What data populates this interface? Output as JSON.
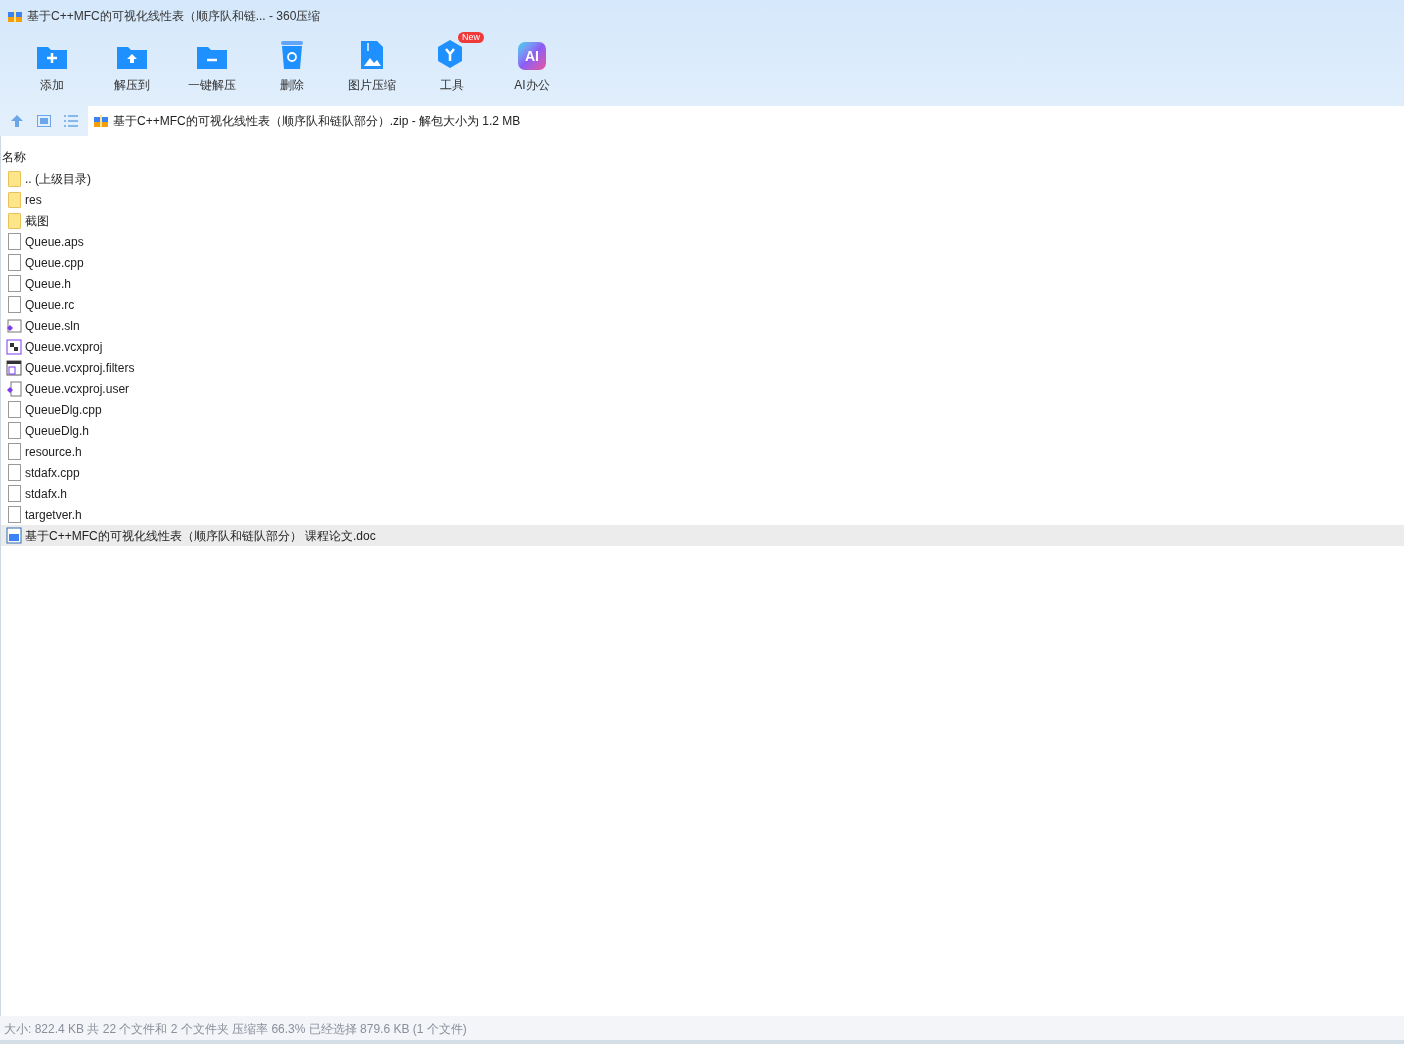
{
  "window": {
    "title": "基于C++MFC的可视化线性表（顺序队和链... - 360压缩"
  },
  "toolbar": [
    {
      "label": "添加",
      "kind": "add"
    },
    {
      "label": "解压到",
      "kind": "extract"
    },
    {
      "label": "一键解压",
      "kind": "oneclick"
    },
    {
      "label": "删除",
      "kind": "delete"
    },
    {
      "label": "图片压缩",
      "kind": "image"
    },
    {
      "label": "工具",
      "kind": "tools",
      "badge": "New"
    },
    {
      "label": "AI办公",
      "kind": "ai",
      "icon_text": "AI"
    }
  ],
  "address": {
    "path": "基于C++MFC的可视化线性表（顺序队和链队部分）.zip - 解包大小为 1.2 MB"
  },
  "table": {
    "columns": [
      "名称"
    ],
    "rows": [
      {
        "name": ".. (上级目录)",
        "kind": "folder",
        "selected": false
      },
      {
        "name": "res",
        "kind": "folder",
        "selected": false
      },
      {
        "name": "截图",
        "kind": "folder",
        "selected": false
      },
      {
        "name": "Queue.aps",
        "kind": "file",
        "selected": false
      },
      {
        "name": "Queue.cpp",
        "kind": "file",
        "selected": false
      },
      {
        "name": "Queue.h",
        "kind": "file",
        "selected": false
      },
      {
        "name": "Queue.rc",
        "kind": "file",
        "selected": false
      },
      {
        "name": "Queue.sln",
        "kind": "sln",
        "selected": false
      },
      {
        "name": "Queue.vcxproj",
        "kind": "vcxproj",
        "selected": false
      },
      {
        "name": "Queue.vcxproj.filters",
        "kind": "filters",
        "selected": false
      },
      {
        "name": "Queue.vcxproj.user",
        "kind": "user",
        "selected": false
      },
      {
        "name": "QueueDlg.cpp",
        "kind": "file",
        "selected": false
      },
      {
        "name": "QueueDlg.h",
        "kind": "file",
        "selected": false
      },
      {
        "name": "resource.h",
        "kind": "file",
        "selected": false
      },
      {
        "name": "stdafx.cpp",
        "kind": "file",
        "selected": false
      },
      {
        "name": "stdafx.h",
        "kind": "file",
        "selected": false
      },
      {
        "name": "targetver.h",
        "kind": "file",
        "selected": false
      },
      {
        "name": "基于C++MFC的可视化线性表（顺序队和链队部分） 课程论文.doc",
        "kind": "doc",
        "selected": true
      }
    ]
  },
  "status_bar": "大小: 822.4 KB 共 22 个文件和 2 个文件夹 压缩率 66.3% 已经选择 879.6 KB (1 个文件)"
}
